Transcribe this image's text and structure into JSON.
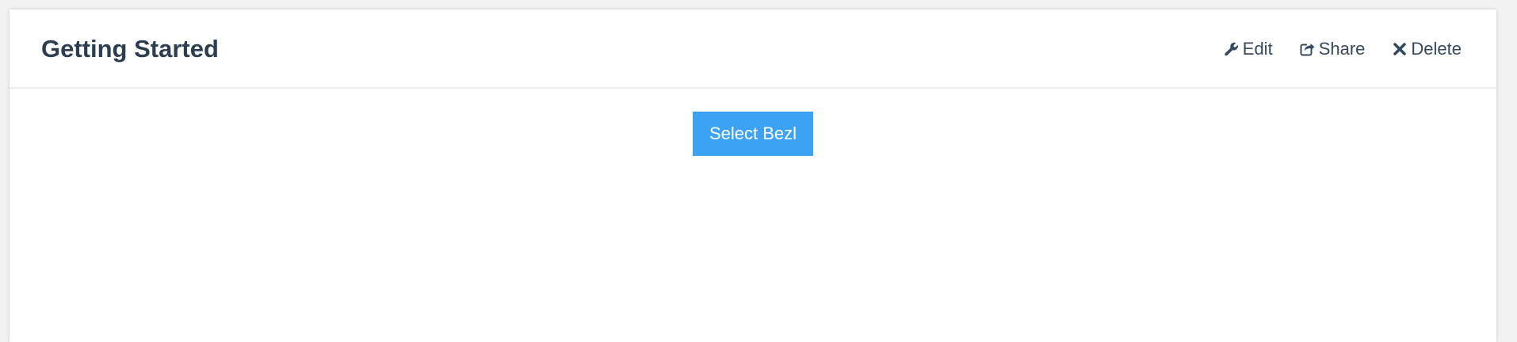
{
  "panel": {
    "title": "Getting Started",
    "actions": {
      "edit": {
        "label": "Edit",
        "icon": "wrench-icon"
      },
      "share": {
        "label": "Share",
        "icon": "share-icon"
      },
      "delete": {
        "label": "Delete",
        "icon": "close-icon"
      }
    }
  },
  "body": {
    "select_button_label": "Select Bezl"
  },
  "colors": {
    "accent": "#3ea2f2",
    "title": "#2c3e50",
    "action_text": "#34495e",
    "background": "#f2f2f2"
  }
}
